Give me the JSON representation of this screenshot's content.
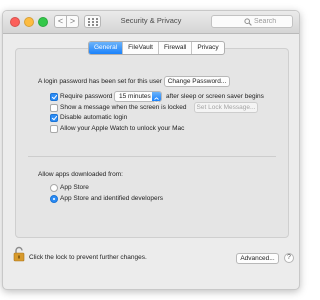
{
  "window": {
    "title": "Security & Privacy"
  },
  "toolbar": {
    "search_placeholder": "Search",
    "back_glyph": "<",
    "forward_glyph": ">"
  },
  "tabs": [
    {
      "label": "General",
      "active": true
    },
    {
      "label": "FileVault",
      "active": false
    },
    {
      "label": "Firewall",
      "active": false
    },
    {
      "label": "Privacy",
      "active": false
    }
  ],
  "general": {
    "login_password_text": "A login password has been set for this user",
    "change_password_label": "Change Password...",
    "require_password": {
      "label": "Require password",
      "checked": true,
      "selected_value": "15 minutes",
      "suffix": "after sleep or screen saver begins"
    },
    "show_message": {
      "label": "Show a message when the screen is locked",
      "checked": false,
      "button_label": "Set Lock Message..."
    },
    "disable_auto_login": {
      "label": "Disable automatic login",
      "checked": true
    },
    "apple_watch": {
      "label": "Allow your Apple Watch to unlock your Mac",
      "checked": false
    }
  },
  "downloads": {
    "heading": "Allow apps downloaded from:",
    "options": [
      {
        "label": "App Store",
        "selected": false
      },
      {
        "label": "App Store and identified developers",
        "selected": true
      }
    ]
  },
  "footer": {
    "lock_text": "Click the lock to prevent further changes.",
    "advanced_label": "Advanced...",
    "help_glyph": "?"
  },
  "colors": {
    "accent": "#2b8cf6",
    "lock_body": "#d79a2c"
  },
  "icons": [
    "grid-icon",
    "search-icon",
    "lock-icon",
    "help-icon",
    "chevron-updown-icon"
  ]
}
